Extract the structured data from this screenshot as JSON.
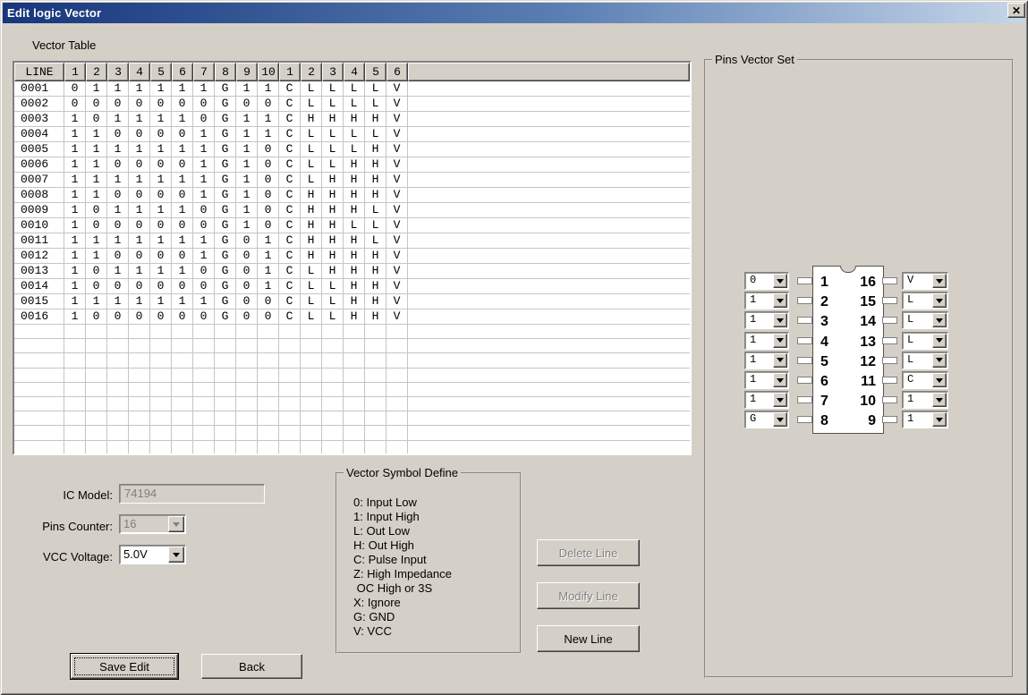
{
  "window": {
    "title": "Edit logic Vector",
    "close_glyph": "✕"
  },
  "colors": {
    "face": "#d4d0c8",
    "titlebar_left": "#17367c",
    "titlebar_right": "#c6d6e9",
    "grid_line": "#c5c5c5",
    "disabled_text": "#808080"
  },
  "vector_table": {
    "label": "Vector Table",
    "columns": [
      "LINE",
      "1",
      "2",
      "3",
      "4",
      "5",
      "6",
      "7",
      "8",
      "9",
      "10",
      "1",
      "2",
      "3",
      "4",
      "5",
      "6"
    ],
    "rows": [
      [
        "0001",
        "0",
        "1",
        "1",
        "1",
        "1",
        "1",
        "1",
        "G",
        "1",
        "1",
        "C",
        "L",
        "L",
        "L",
        "L",
        "V"
      ],
      [
        "0002",
        "0",
        "0",
        "0",
        "0",
        "0",
        "0",
        "0",
        "G",
        "0",
        "0",
        "C",
        "L",
        "L",
        "L",
        "L",
        "V"
      ],
      [
        "0003",
        "1",
        "0",
        "1",
        "1",
        "1",
        "1",
        "0",
        "G",
        "1",
        "1",
        "C",
        "H",
        "H",
        "H",
        "H",
        "V"
      ],
      [
        "0004",
        "1",
        "1",
        "0",
        "0",
        "0",
        "0",
        "1",
        "G",
        "1",
        "1",
        "C",
        "L",
        "L",
        "L",
        "L",
        "V"
      ],
      [
        "0005",
        "1",
        "1",
        "1",
        "1",
        "1",
        "1",
        "1",
        "G",
        "1",
        "0",
        "C",
        "L",
        "L",
        "L",
        "H",
        "V"
      ],
      [
        "0006",
        "1",
        "1",
        "0",
        "0",
        "0",
        "0",
        "1",
        "G",
        "1",
        "0",
        "C",
        "L",
        "L",
        "H",
        "H",
        "V"
      ],
      [
        "0007",
        "1",
        "1",
        "1",
        "1",
        "1",
        "1",
        "1",
        "G",
        "1",
        "0",
        "C",
        "L",
        "H",
        "H",
        "H",
        "V"
      ],
      [
        "0008",
        "1",
        "1",
        "0",
        "0",
        "0",
        "0",
        "1",
        "G",
        "1",
        "0",
        "C",
        "H",
        "H",
        "H",
        "H",
        "V"
      ],
      [
        "0009",
        "1",
        "0",
        "1",
        "1",
        "1",
        "1",
        "0",
        "G",
        "1",
        "0",
        "C",
        "H",
        "H",
        "H",
        "L",
        "V"
      ],
      [
        "0010",
        "1",
        "0",
        "0",
        "0",
        "0",
        "0",
        "0",
        "G",
        "1",
        "0",
        "C",
        "H",
        "H",
        "L",
        "L",
        "V"
      ],
      [
        "0011",
        "1",
        "1",
        "1",
        "1",
        "1",
        "1",
        "1",
        "G",
        "0",
        "1",
        "C",
        "H",
        "H",
        "H",
        "L",
        "V"
      ],
      [
        "0012",
        "1",
        "1",
        "0",
        "0",
        "0",
        "0",
        "1",
        "G",
        "0",
        "1",
        "C",
        "H",
        "H",
        "H",
        "H",
        "V"
      ],
      [
        "0013",
        "1",
        "0",
        "1",
        "1",
        "1",
        "1",
        "0",
        "G",
        "0",
        "1",
        "C",
        "L",
        "H",
        "H",
        "H",
        "V"
      ],
      [
        "0014",
        "1",
        "0",
        "0",
        "0",
        "0",
        "0",
        "0",
        "G",
        "0",
        "1",
        "C",
        "L",
        "L",
        "H",
        "H",
        "V"
      ],
      [
        "0015",
        "1",
        "1",
        "1",
        "1",
        "1",
        "1",
        "1",
        "G",
        "0",
        "0",
        "C",
        "L",
        "L",
        "H",
        "H",
        "V"
      ],
      [
        "0016",
        "1",
        "0",
        "0",
        "0",
        "0",
        "0",
        "0",
        "G",
        "0",
        "0",
        "C",
        "L",
        "L",
        "H",
        "H",
        "V"
      ]
    ],
    "empty_row_count": 9
  },
  "form": {
    "ic_model_label": "IC Model:",
    "ic_model_value": "74194",
    "pins_counter_label": "Pins Counter:",
    "pins_counter_value": "16",
    "vcc_voltage_label": "VCC Voltage:",
    "vcc_voltage_value": "5.0V"
  },
  "symbol_define": {
    "title": "Vector Symbol Define",
    "lines": [
      "0: Input Low",
      "1: Input High",
      "L: Out Low",
      "H: Out High",
      "C: Pulse Input",
      "Z: High Impedance",
      " OC High or 3S",
      "X: Ignore",
      "G: GND",
      "V: VCC"
    ]
  },
  "actions": {
    "delete_line": "Delete Line",
    "modify_line": "Modify Line",
    "new_line": "New Line",
    "save_edit": "Save Edit",
    "back": "Back"
  },
  "pins_vector_set": {
    "title": "Pins Vector Set",
    "left_pins": [
      {
        "pin": "1",
        "value": "0"
      },
      {
        "pin": "2",
        "value": "1"
      },
      {
        "pin": "3",
        "value": "1"
      },
      {
        "pin": "4",
        "value": "1"
      },
      {
        "pin": "5",
        "value": "1"
      },
      {
        "pin": "6",
        "value": "1"
      },
      {
        "pin": "7",
        "value": "1"
      },
      {
        "pin": "8",
        "value": "G"
      }
    ],
    "right_pins": [
      {
        "pin": "16",
        "value": "V"
      },
      {
        "pin": "15",
        "value": "L"
      },
      {
        "pin": "14",
        "value": "L"
      },
      {
        "pin": "13",
        "value": "L"
      },
      {
        "pin": "12",
        "value": "L"
      },
      {
        "pin": "11",
        "value": "C"
      },
      {
        "pin": "10",
        "value": "1"
      },
      {
        "pin": "9",
        "value": "1"
      }
    ]
  }
}
